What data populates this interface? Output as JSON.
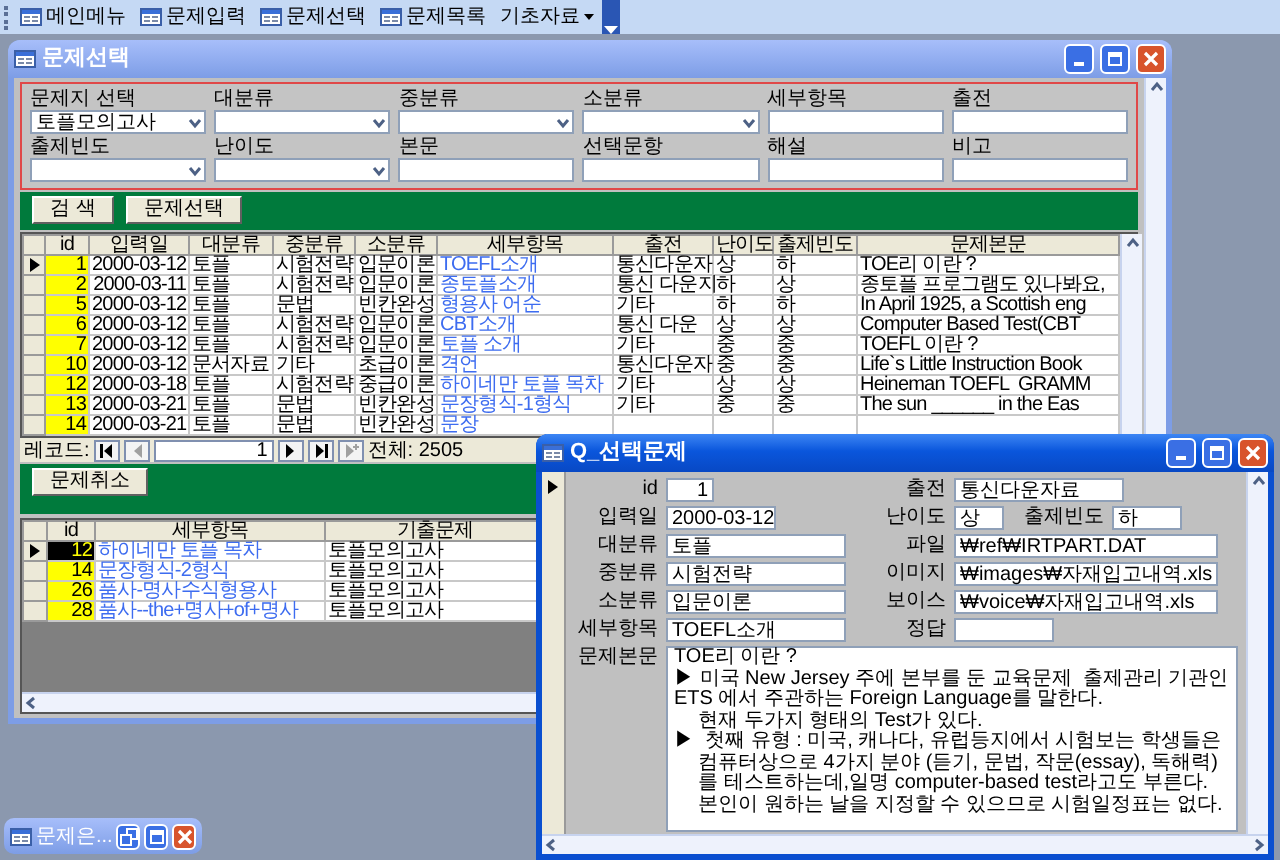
{
  "toolbar": [
    {
      "label": "메인메뉴",
      "kind": "form"
    },
    {
      "label": "문제입력",
      "kind": "form"
    },
    {
      "label": "문제선택",
      "kind": "form"
    },
    {
      "label": "문제목록",
      "kind": "form"
    },
    {
      "label": "기초자료",
      "kind": "menu"
    }
  ],
  "main_window": {
    "title": "문제선택",
    "active": false,
    "filters": [
      {
        "label": "문제지 선택",
        "kind": "combo",
        "value": "토플모의고사"
      },
      {
        "label": "대분류",
        "kind": "combo"
      },
      {
        "label": "중분류",
        "kind": "combo"
      },
      {
        "label": "소분류",
        "kind": "combo"
      },
      {
        "label": "세부항목",
        "kind": "text"
      },
      {
        "label": "출전",
        "kind": "text"
      },
      {
        "label": "출제빈도",
        "kind": "combo"
      },
      {
        "label": "난이도",
        "kind": "combo"
      },
      {
        "label": "본문",
        "kind": "text"
      },
      {
        "label": "선택문항",
        "kind": "text"
      },
      {
        "label": "해설",
        "kind": "text"
      },
      {
        "label": "비고",
        "kind": "text"
      }
    ],
    "buttons": [
      "검 색",
      "문제선택"
    ],
    "grid": {
      "columns": [
        {
          "label": "id",
          "kind": "number"
        },
        {
          "label": "입력일",
          "kind": "date"
        },
        {
          "label": "대분류",
          "kind": "text"
        },
        {
          "label": "중분류",
          "kind": "text"
        },
        {
          "label": "소분류",
          "kind": "text"
        },
        {
          "label": "세부항목",
          "kind": "link"
        },
        {
          "label": "출전",
          "kind": "text"
        },
        {
          "label": "난이도",
          "kind": "text"
        },
        {
          "label": "출제빈도",
          "kind": "text"
        },
        {
          "label": "문제본문",
          "kind": "text"
        }
      ],
      "rows": [
        {
          "selected": true,
          "cells": [
            "1",
            "2000-03-12",
            "토플",
            "시험전략",
            "입문이론",
            "TOEFL소개",
            "통신다운자",
            "상",
            "하",
            "TOE리 이란 ?"
          ]
        },
        {
          "selected": false,
          "cells": [
            "2",
            "2000-03-11",
            "토플",
            "시험전략",
            "입문이론",
            "종토플소개",
            "통신 다운지",
            "하",
            "상",
            "종토플 프로그램도 있나봐요,"
          ]
        },
        {
          "selected": false,
          "cells": [
            "5",
            "2000-03-12",
            "토플",
            "문법",
            "빈칸완성",
            "형용사 어순",
            "기타",
            "하",
            "하",
            "In April 1925, a Scottish eng"
          ]
        },
        {
          "selected": false,
          "cells": [
            "6",
            "2000-03-12",
            "토플",
            "시험전략",
            "입문이론",
            "CBT소개",
            "통신 다운",
            "상",
            "상",
            "Computer Based Test(CBT"
          ]
        },
        {
          "selected": false,
          "cells": [
            "7",
            "2000-03-12",
            "토플",
            "시험전략",
            "입문이론",
            "토플 소개",
            "기타",
            "중",
            "중",
            "TOEFL 이란 ?"
          ]
        },
        {
          "selected": false,
          "cells": [
            "10",
            "2000-03-12",
            "문서자료",
            "기타",
            "초급이론",
            "격언",
            "통신다운자",
            "중",
            "중",
            "Life`s Little Instruction Book"
          ]
        },
        {
          "selected": false,
          "cells": [
            "12",
            "2000-03-18",
            "토플",
            "시험전략",
            "중급이론",
            "하이네만 토플 목차",
            "기타",
            "상",
            "상",
            "Heineman TOEFL  GRAMM"
          ]
        },
        {
          "selected": false,
          "cells": [
            "13",
            "2000-03-21",
            "토플",
            "문법",
            "빈칸완성",
            "문장형식-1형식",
            "기타",
            "중",
            "중",
            "The sun ______ in the Eas"
          ]
        },
        {
          "selected": false,
          "cells": [
            "14",
            "2000-03-21",
            "토플",
            "문법",
            "빈칸완성",
            "문장"
          ]
        }
      ]
    },
    "record_nav": {
      "label": "레코드:",
      "current": "1",
      "total": "전체: 2505"
    },
    "cancel_button": "문제취소",
    "subgrid": {
      "columns": [
        {
          "label": "id",
          "kind": "number"
        },
        {
          "label": "세부항목",
          "kind": "link"
        },
        {
          "label": "기출문제",
          "kind": "text"
        }
      ],
      "rows": [
        {
          "selected": true,
          "cells": [
            "12",
            "하이네만 토플 목차",
            "토플모의고사"
          ]
        },
        {
          "selected": false,
          "cells": [
            "14",
            "문장형식-2형식",
            "토플모의고사"
          ]
        },
        {
          "selected": false,
          "cells": [
            "26",
            "품사-명사수식형용사",
            "토플모의고사"
          ]
        },
        {
          "selected": false,
          "cells": [
            "28",
            "품사--the+명사+of+명사",
            "토플모의고사"
          ]
        }
      ]
    }
  },
  "popup": {
    "title": "Q_선택문제",
    "active": true,
    "rows": [
      [
        {
          "label": "id",
          "value": "1"
        },
        {
          "label": "출전",
          "value": "통신다운자료"
        }
      ],
      [
        {
          "label": "입력일",
          "value": "2000-03-12"
        },
        {
          "label": "난이도",
          "value": "상"
        },
        {
          "label": "출제빈도",
          "value": "하"
        }
      ],
      [
        {
          "label": "대분류",
          "value": "토플"
        },
        {
          "label": "파일",
          "value": "₩ref₩IRTPART.DAT"
        }
      ],
      [
        {
          "label": "중분류",
          "value": "시험전략"
        },
        {
          "label": "이미지",
          "value": "₩images₩자재입고내역.xls"
        }
      ],
      [
        {
          "label": "소분류",
          "value": "입문이론"
        },
        {
          "label": "보이스",
          "value": "₩voice₩자재입고내역.xls"
        }
      ],
      [
        {
          "label": "세부항목",
          "value": "TOEFL소개"
        },
        {
          "label": "정답"
        }
      ]
    ],
    "body_label": "문제본문",
    "body": [
      {
        "kind": "plain",
        "text": "TOE리 이란 ?"
      },
      {
        "kind": "plain",
        "text": "▶ 미국 New Jersey 주에 본부를 둔 교육문제  출제관리 기관인 ETS 에서 주관하는 Foreign Language를 말한다."
      },
      {
        "kind": "indented",
        "text": "현재 두가지 형태의 Test가 있다."
      },
      {
        "kind": "hanging",
        "text": "▶  첫째 유형 : 미국, 캐나다, 유럽등지에서 시험보는 학생들은 컴퓨터상으로 4가지 분야 (듣기, 문법, 작문(essay), 독해력)를 테스트하는데,일명 computer-based test라고도 부른다. 본인이 원하는 날을 지정할 수 있으므로 시험일정표는 없다."
      }
    ]
  },
  "minimized": {
    "title": "문제은..."
  }
}
